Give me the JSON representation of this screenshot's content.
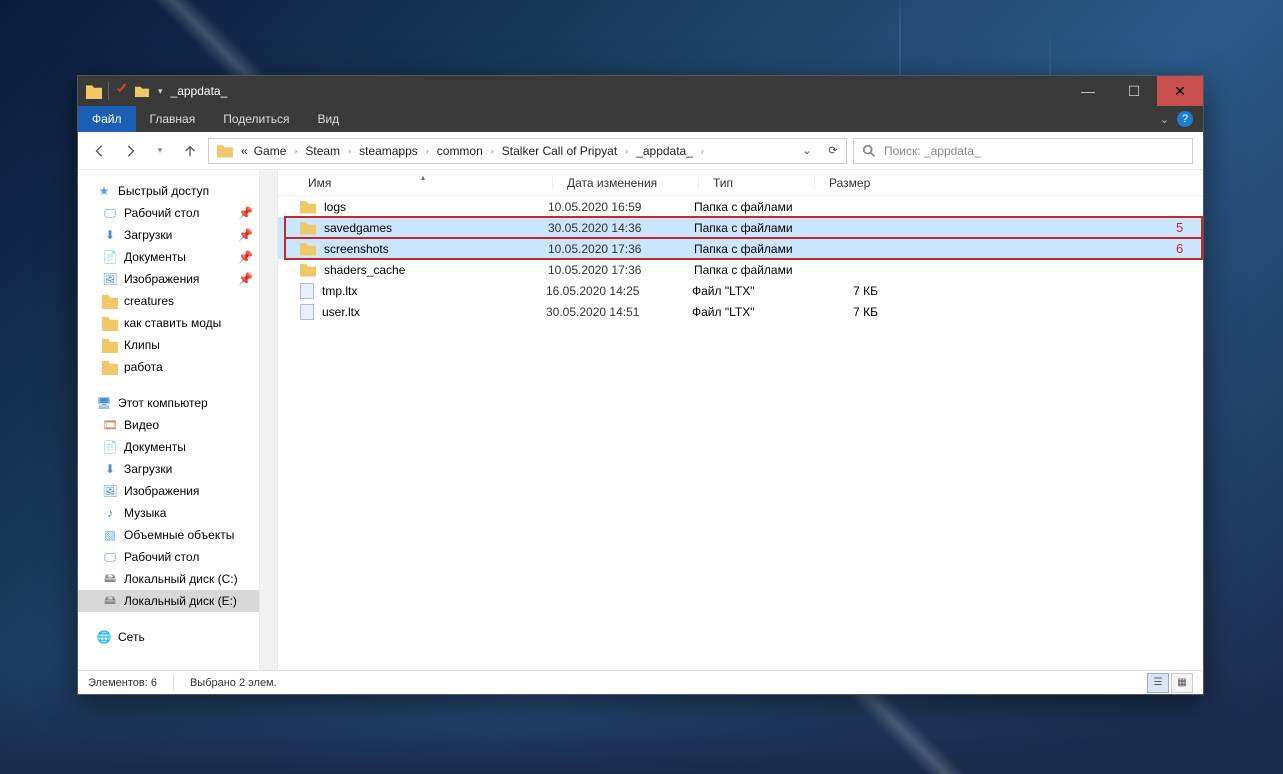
{
  "window": {
    "title": "_appdata_"
  },
  "ribbon": {
    "file": "Файл",
    "home": "Главная",
    "share": "Поделиться",
    "view": "Вид"
  },
  "breadcrumb": [
    "Game",
    "Steam",
    "steamapps",
    "common",
    "Stalker Call of Pripyat",
    "_appdata_"
  ],
  "breadcrumb_prefix": "«",
  "search": {
    "placeholder": "Поиск: _appdata_"
  },
  "columns": {
    "name": "Имя",
    "date": "Дата изменения",
    "type": "Тип",
    "size": "Размер"
  },
  "items": [
    {
      "name": "logs",
      "date": "10.05.2020 16:59",
      "type": "Папка с файлами",
      "size": "",
      "icon": "folder",
      "selected": false,
      "hl": false
    },
    {
      "name": "savedgames",
      "date": "30.05.2020 14:36",
      "type": "Папка с файлами",
      "size": "",
      "icon": "folder",
      "selected": true,
      "hl": true,
      "annot": "5"
    },
    {
      "name": "screenshots",
      "date": "10.05.2020 17:36",
      "type": "Папка с файлами",
      "size": "",
      "icon": "folder",
      "selected": true,
      "hl": true,
      "annot": "6"
    },
    {
      "name": "shaders_cache",
      "date": "10.05.2020 17:36",
      "type": "Папка с файлами",
      "size": "",
      "icon": "folder",
      "selected": false,
      "hl": false
    },
    {
      "name": "tmp.ltx",
      "date": "16.05.2020 14:25",
      "type": "Файл \"LTX\"",
      "size": "7 КБ",
      "icon": "file",
      "selected": false,
      "hl": false
    },
    {
      "name": "user.ltx",
      "date": "30.05.2020 14:51",
      "type": "Файл \"LTX\"",
      "size": "7 КБ",
      "icon": "file",
      "selected": false,
      "hl": false
    }
  ],
  "sidebar": {
    "quick": "Быстрый доступ",
    "quick_items": [
      {
        "label": "Рабочий стол",
        "icon": "desktop",
        "pin": true
      },
      {
        "label": "Загрузки",
        "icon": "download",
        "pin": true
      },
      {
        "label": "Документы",
        "icon": "docs",
        "pin": true
      },
      {
        "label": "Изображения",
        "icon": "images",
        "pin": true
      },
      {
        "label": "creatures",
        "icon": "folder",
        "pin": false
      },
      {
        "label": "как ставить моды",
        "icon": "folder",
        "pin": false
      },
      {
        "label": "Клипы",
        "icon": "folder",
        "pin": false
      },
      {
        "label": "работа",
        "icon": "folder",
        "pin": false
      }
    ],
    "pc": "Этот компьютер",
    "pc_items": [
      {
        "label": "Видео",
        "icon": "video"
      },
      {
        "label": "Документы",
        "icon": "docs"
      },
      {
        "label": "Загрузки",
        "icon": "download"
      },
      {
        "label": "Изображения",
        "icon": "images"
      },
      {
        "label": "Музыка",
        "icon": "music"
      },
      {
        "label": "Объемные объекты",
        "icon": "obj"
      },
      {
        "label": "Рабочий стол",
        "icon": "desktop"
      },
      {
        "label": "Локальный диск (C:)",
        "icon": "disk"
      },
      {
        "label": "Локальный диск (E:)",
        "icon": "disk",
        "selected": true
      }
    ],
    "net": "Сеть"
  },
  "status": {
    "count": "Элементов: 6",
    "selected": "Выбрано 2 элем."
  }
}
